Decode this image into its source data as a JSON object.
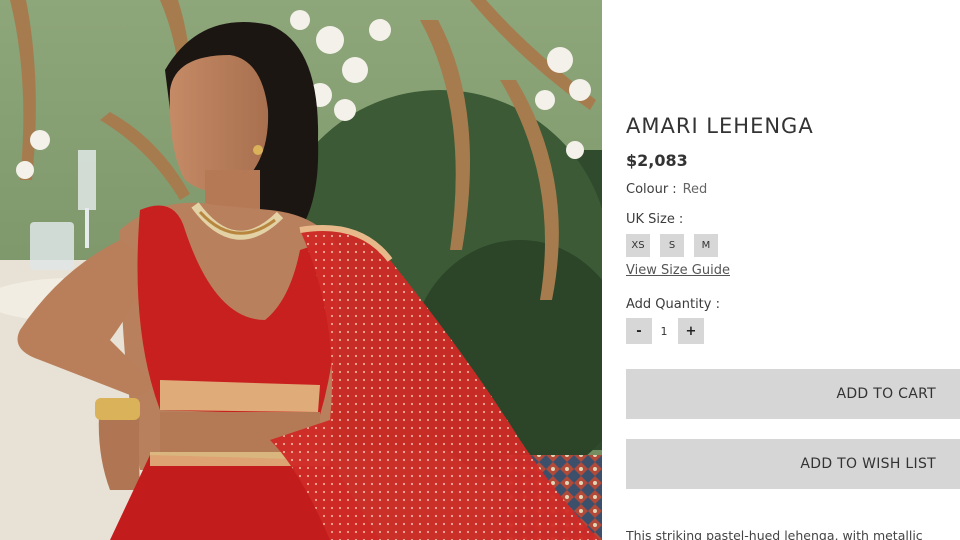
{
  "product": {
    "title": "AMARI LEHENGA",
    "price": "$2,083"
  },
  "colour": {
    "label": "Colour",
    "separator": ":",
    "value": "Red"
  },
  "size": {
    "label": "UK Size",
    "separator": ":",
    "options": [
      "XS",
      "S",
      "M"
    ],
    "guide_link": "View Size Guide"
  },
  "quantity": {
    "label": "Add Quantity :",
    "decrement": "-",
    "value": "1",
    "increment": "+"
  },
  "actions": {
    "add_to_cart": "ADD TO CART",
    "add_to_wishlist": "ADD TO WISH LIST"
  },
  "description": "This striking pastel-hued lehenga, with metallic",
  "colors": {
    "button_bg": "#d6d6d6",
    "garment_red": "#c8201f"
  },
  "image": {
    "icon": "product-photo"
  }
}
